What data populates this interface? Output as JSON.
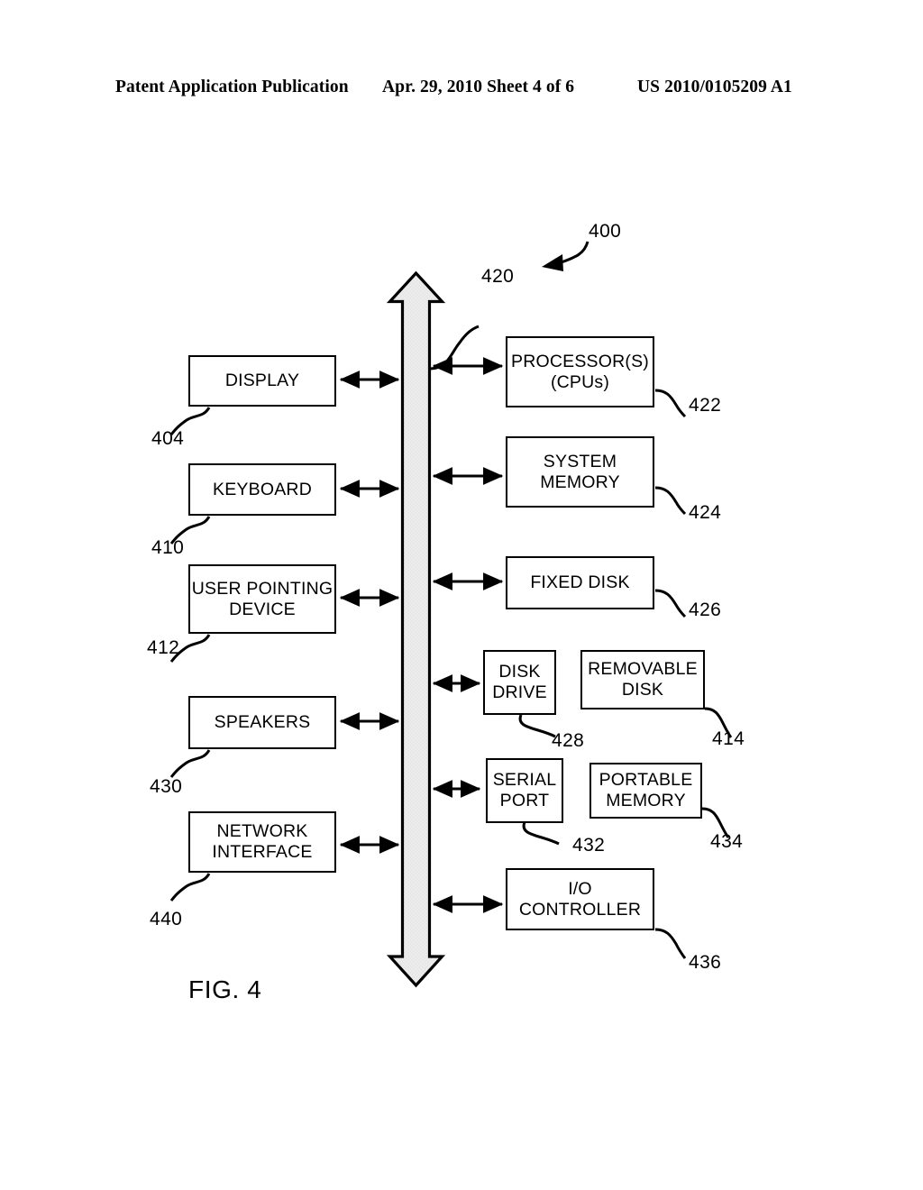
{
  "header": {
    "left": "Patent Application Publication",
    "middle": "Apr. 29, 2010  Sheet 4 of 6",
    "right": "US 2010/0105209 A1"
  },
  "figure": {
    "caption": "FIG. 4",
    "system_ref": "400",
    "bus": {
      "ref": "420",
      "name": "system-bus",
      "fill": "#ebebeb",
      "stroke": "#000000"
    },
    "peripheral_boxes": [
      {
        "label": "DISPLAY",
        "ref": "404"
      },
      {
        "label": "KEYBOARD",
        "ref": "410"
      },
      {
        "label": "USER POINTING\nDEVICE",
        "ref": "412"
      },
      {
        "label": "SPEAKERS",
        "ref": "430"
      },
      {
        "label": "NETWORK\nINTERFACE",
        "ref": "440"
      }
    ],
    "core_boxes": [
      {
        "label": "PROCESSOR(S)\n(CPUs)",
        "ref": "422"
      },
      {
        "label": "SYSTEM\nMEMORY",
        "ref": "424"
      },
      {
        "label": "FIXED DISK",
        "ref": "426"
      },
      {
        "label": "DISK\nDRIVE",
        "ref": "428"
      },
      {
        "label": "SERIAL\nPORT",
        "ref": "432"
      },
      {
        "label": "I/O\nCONTROLLER",
        "ref": "436"
      }
    ],
    "media_boxes": [
      {
        "label": "REMOVABLE\nDISK",
        "ref": "414"
      },
      {
        "label": "PORTABLE\nMEMORY",
        "ref": "434"
      }
    ]
  }
}
